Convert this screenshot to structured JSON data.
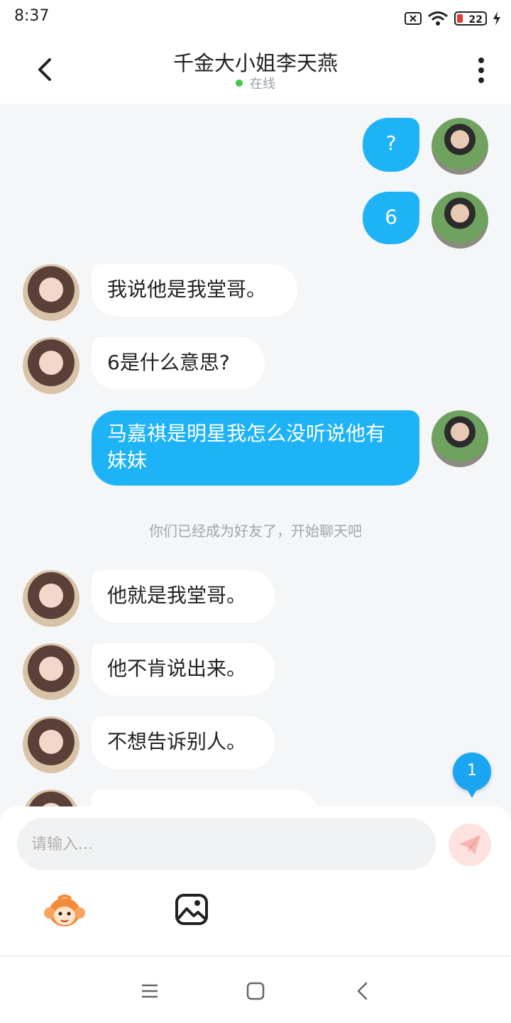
{
  "status_bar": {
    "time": "8:37",
    "battery": "22"
  },
  "header": {
    "title": "千金大小姐李天燕",
    "status": "在线"
  },
  "messages": [
    {
      "side": "out",
      "text": "?"
    },
    {
      "side": "out",
      "text": "6"
    },
    {
      "side": "in",
      "text": "我说他是我堂哥。"
    },
    {
      "side": "in",
      "text": "6是什么意思?"
    },
    {
      "side": "out",
      "text": "马嘉祺是明星我怎么没听说他有妹妹"
    },
    {
      "side": "in",
      "text": "他就是我堂哥。"
    },
    {
      "side": "in",
      "text": "他不肯说出来。"
    },
    {
      "side": "in",
      "text": "不想告诉别人。"
    }
  ],
  "system_notice": "你们已经成为好友了，开始聊天吧",
  "unread_badge": "1",
  "composer": {
    "placeholder": "请输入..."
  },
  "colors": {
    "outgoing_bubble": "#1eb3f7",
    "online_dot": "#3dcc4a",
    "badge": "#1ba5f0"
  }
}
